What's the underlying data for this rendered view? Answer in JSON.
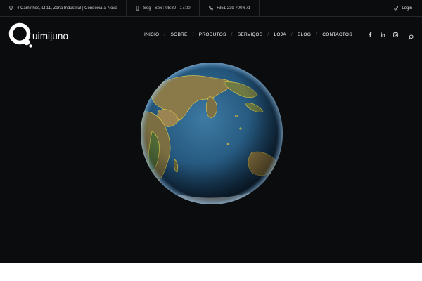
{
  "topbar": {
    "address": "4 Caminhos, Lt 11, Zona Industrial | Condeixa-a-Nova",
    "hours": "Seg - Sex : 08:30 - 17:00",
    "phone": "+351 239 700 671",
    "login": "Login"
  },
  "brand": {
    "name": "uimijuno"
  },
  "nav": {
    "items": [
      "INICIO",
      "SOBRE",
      "PRODUTOS",
      "SERVIÇOS",
      "LOJA",
      "BLOG",
      "CONTACTOS"
    ],
    "separator": "/"
  },
  "icons": {
    "address": "map-pin-icon",
    "hours": "mobile-phone-icon",
    "phone": "phone-icon",
    "login": "key-icon",
    "socials": [
      "facebook-icon",
      "linkedin-icon",
      "instagram-icon"
    ],
    "search": "search-icon"
  },
  "colors": {
    "background": "#0b0c0e",
    "ocean": "#2a5f86",
    "land": "#7a6a3e",
    "borders": "#e8d84a",
    "text": "#ffffff"
  },
  "hero": {
    "image": "globe-earth"
  }
}
